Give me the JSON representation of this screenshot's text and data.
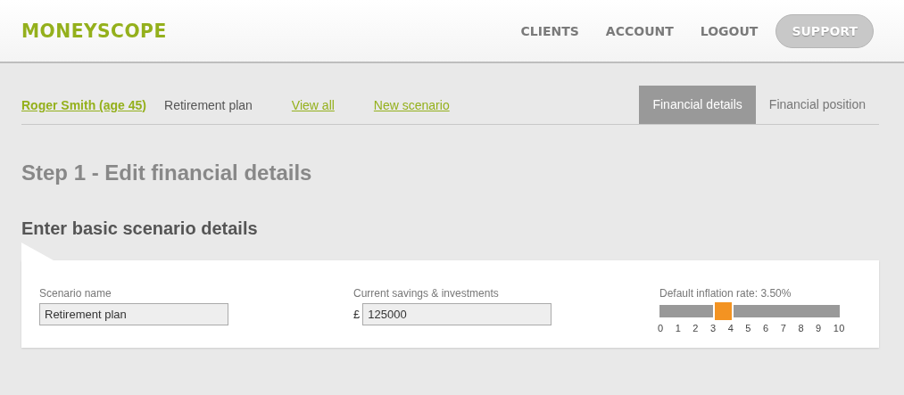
{
  "header": {
    "logo": "MONEYSCOPE",
    "nav": [
      {
        "label": "CLIENTS",
        "kind": "link"
      },
      {
        "label": "ACCOUNT",
        "kind": "link"
      },
      {
        "label": "LOGOUT",
        "kind": "link"
      },
      {
        "label": "SUPPORT",
        "kind": "pill"
      }
    ]
  },
  "breadcrumb": {
    "client": "Roger Smith (age 45)",
    "plan": "Retirement plan",
    "links": [
      "View all",
      "New scenario"
    ]
  },
  "tabs": [
    {
      "label": "Financial details",
      "selected": true
    },
    {
      "label": "Financial position",
      "selected": false
    }
  ],
  "title": "Step 1 - Edit financial details",
  "section": "Enter basic scenario details",
  "form": {
    "scenario_name": {
      "label": "Scenario name",
      "value": "Retirement plan"
    },
    "savings": {
      "label": "Current savings & investments",
      "currency": "£",
      "value": "125000"
    },
    "inflation": {
      "label": "Default inflation rate: 3.50%",
      "level": 0.35,
      "ticks": [
        "0",
        "1",
        "2",
        "3",
        "4",
        "5",
        "6",
        "7",
        "8",
        "9",
        "10"
      ]
    }
  }
}
